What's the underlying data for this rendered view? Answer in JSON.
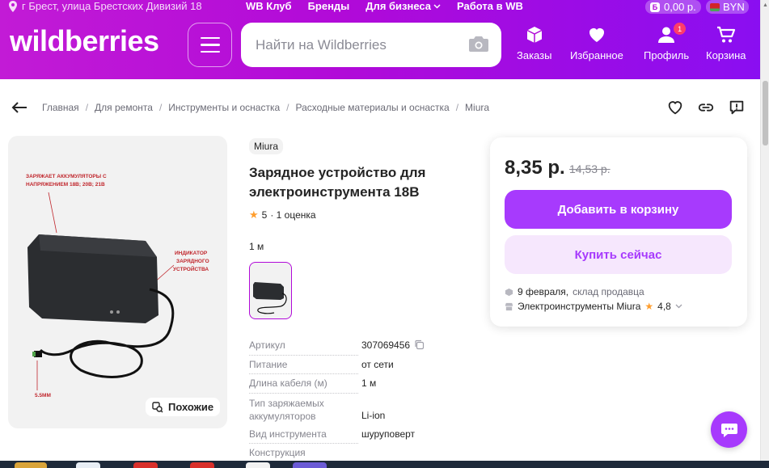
{
  "header": {
    "location": "г Брест, улица Брестских Дивизий 18",
    "top_links": [
      "WB Клуб",
      "Бренды"
    ],
    "business_link": "Для бизнеса",
    "work_link": "Работа в WB",
    "wallet_badge": "Б",
    "wallet_amount": "0,00 р.",
    "currency": "BYN",
    "logo": "wildberries",
    "search_placeholder": "Найти на Wildberries",
    "nav": {
      "orders": "Заказы",
      "favorites": "Избранное",
      "profile": "Профиль",
      "profile_badge": "1",
      "cart": "Корзина"
    }
  },
  "breadcrumbs": [
    "Главная",
    "Для ремонта",
    "Инструменты и оснастка",
    "Расходные материалы и оснастка",
    "Miura"
  ],
  "gallery": {
    "similar_label": "Похожие",
    "image_texts": {
      "caption1": "ЗАРЯЖАЕТ АККУМУЛЯТОРЫ С НАПРЯЖЕНИЕМ 18В; 20В; 21В",
      "caption2": "ИНДИКАТОР ЗАРЯДНОГО УСТРОЙСТВА",
      "caption3": "5.5ММ"
    }
  },
  "product": {
    "brand": "Miura",
    "title": "Зарядное устройство для электроинструмента 18В",
    "rating": "5",
    "reviews": "· 1 оценка",
    "variant_label": "1 м",
    "specs": [
      {
        "key": "Артикул",
        "value": "307069456"
      },
      {
        "key": "Питание",
        "value": "от сети"
      },
      {
        "key": "Длина кабеля (м)",
        "value": "1 м"
      },
      {
        "key": "Тип заряжаемых аккумуляторов",
        "value": "Li-ion"
      },
      {
        "key": "Вид инструмента",
        "value": "шуруповерт"
      },
      {
        "key": "Конструкция",
        "value": ""
      }
    ]
  },
  "card": {
    "price": "8,35 р.",
    "old_price": "14,53 р.",
    "add_to_cart": "Добавить в корзину",
    "buy_now": "Купить сейчас",
    "delivery_date": "9 февраля,",
    "delivery_source": "склад продавца",
    "seller": "Электроинструменты Miura",
    "seller_rating": "4,8"
  },
  "colors": {
    "brand_gradient_start": "#c21bd6",
    "brand_gradient_end": "#8a0ef1",
    "button_primary": "#a73afd",
    "button_secondary_bg": "#f6e7fd",
    "star": "#ff9e2e"
  }
}
